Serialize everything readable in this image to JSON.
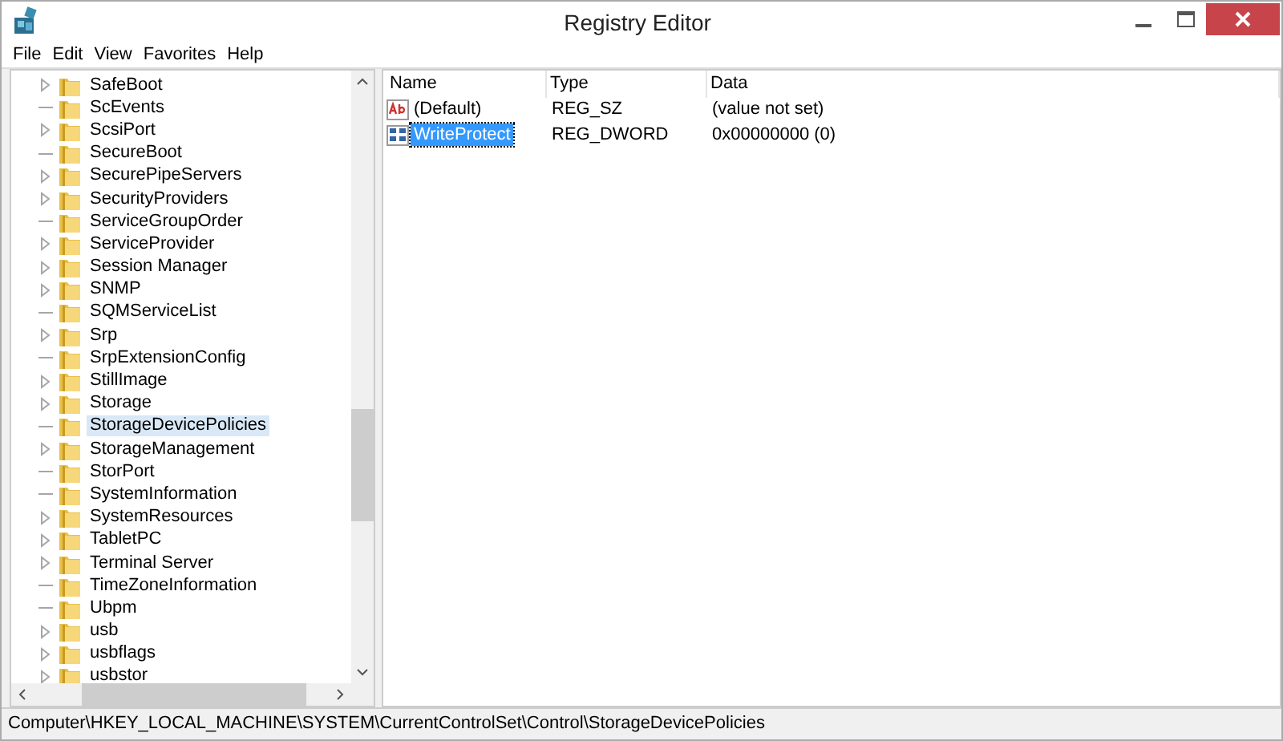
{
  "window": {
    "title": "Registry Editor"
  },
  "menu": [
    "File",
    "Edit",
    "View",
    "Favorites",
    "Help"
  ],
  "tree": {
    "items": [
      {
        "label": "SafeBoot",
        "expandable": true,
        "selected": false
      },
      {
        "label": "ScEvents",
        "expandable": false,
        "selected": false
      },
      {
        "label": "ScsiPort",
        "expandable": true,
        "selected": false
      },
      {
        "label": "SecureBoot",
        "expandable": false,
        "selected": false
      },
      {
        "label": "SecurePipeServers",
        "expandable": true,
        "selected": false
      },
      {
        "label": "SecurityProviders",
        "expandable": true,
        "selected": false
      },
      {
        "label": "ServiceGroupOrder",
        "expandable": false,
        "selected": false
      },
      {
        "label": "ServiceProvider",
        "expandable": true,
        "selected": false
      },
      {
        "label": "Session Manager",
        "expandable": true,
        "selected": false
      },
      {
        "label": "SNMP",
        "expandable": true,
        "selected": false
      },
      {
        "label": "SQMServiceList",
        "expandable": false,
        "selected": false
      },
      {
        "label": "Srp",
        "expandable": true,
        "selected": false
      },
      {
        "label": "SrpExtensionConfig",
        "expandable": false,
        "selected": false
      },
      {
        "label": "StillImage",
        "expandable": true,
        "selected": false
      },
      {
        "label": "Storage",
        "expandable": true,
        "selected": false
      },
      {
        "label": "StorageDevicePolicies",
        "expandable": false,
        "selected": true
      },
      {
        "label": "StorageManagement",
        "expandable": true,
        "selected": false
      },
      {
        "label": "StorPort",
        "expandable": false,
        "selected": false
      },
      {
        "label": "SystemInformation",
        "expandable": false,
        "selected": false
      },
      {
        "label": "SystemResources",
        "expandable": true,
        "selected": false
      },
      {
        "label": "TabletPC",
        "expandable": true,
        "selected": false
      },
      {
        "label": "Terminal Server",
        "expandable": true,
        "selected": false
      },
      {
        "label": "TimeZoneInformation",
        "expandable": false,
        "selected": false
      },
      {
        "label": "Ubpm",
        "expandable": false,
        "selected": false
      },
      {
        "label": "usb",
        "expandable": true,
        "selected": false
      },
      {
        "label": "usbflags",
        "expandable": true,
        "selected": false
      },
      {
        "label": "usbstor",
        "expandable": true,
        "selected": false
      }
    ]
  },
  "values": {
    "columns": [
      "Name",
      "Type",
      "Data"
    ],
    "rows": [
      {
        "kind": "string",
        "name": "(Default)",
        "type": "REG_SZ",
        "data": "(value not set)",
        "selected": false
      },
      {
        "kind": "binary",
        "name": "WriteProtect",
        "type": "REG_DWORD",
        "data": "0x00000000 (0)",
        "selected": true
      }
    ]
  },
  "status_bar": "Computer\\HKEY_LOCAL_MACHINE\\SYSTEM\\CurrentControlSet\\Control\\StorageDevicePolicies"
}
